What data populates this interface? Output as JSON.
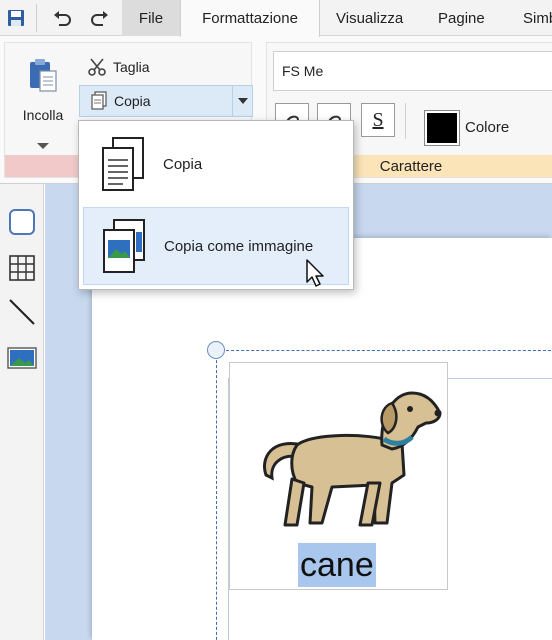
{
  "tabs": {
    "file": "File",
    "format": "Formattazione",
    "view": "Visualizza",
    "pages": "Pagine",
    "symbols": "Simb"
  },
  "clipboard": {
    "paste_label": "Incolla",
    "cut_label": "Taglia",
    "copy_label": "Copia"
  },
  "character": {
    "font_value": "FS Me",
    "color_label": "Colore",
    "color_value": "#000000",
    "group_label": "Carattere",
    "underline_glyph": "S"
  },
  "copy_menu": {
    "items": [
      {
        "label": "Copia",
        "icon": "document-copy-icon"
      },
      {
        "label": "Copia come immagine",
        "icon": "image-copy-icon"
      }
    ]
  },
  "canvas": {
    "symbol_word": "cane",
    "symbol_icon": "dog-icon"
  },
  "colors": {
    "clipboard_group_accent": "#f2c9c9",
    "character_group_accent": "#fbe4b8",
    "highlight": "#dce9f7",
    "canvas_bg": "#c7d8ef",
    "word_highlight": "#a9c6ec"
  }
}
